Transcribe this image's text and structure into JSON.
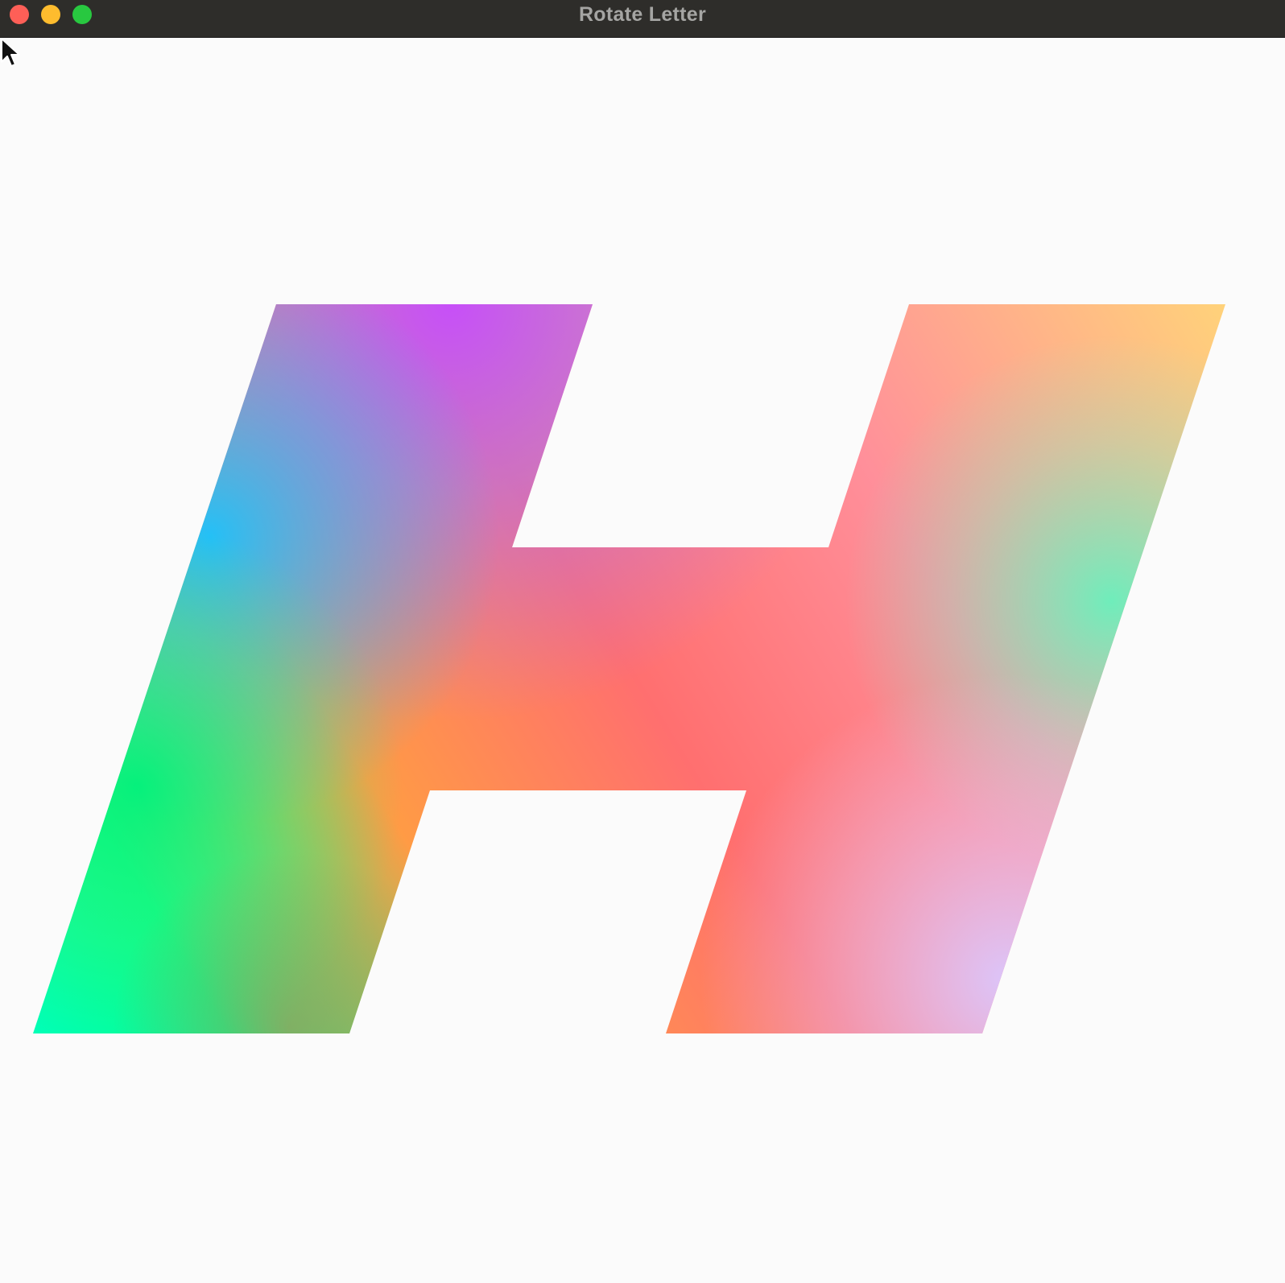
{
  "window": {
    "title": "Rotate Letter",
    "controls": {
      "close": {
        "color": "#fe5f57"
      },
      "minimize": {
        "color": "#febc2e"
      },
      "zoom": {
        "color": "#28c840"
      }
    }
  },
  "canvas": {
    "background": "#fbfbfb",
    "glyph": {
      "letter": "H",
      "style": "italic-skewed",
      "gradient_colors": [
        "#b44dff",
        "#1ec8ff",
        "#00ff8a",
        "#ff9a4a",
        "#ff5f6d",
        "#ffd27a",
        "#6bffbf",
        "#d9c6ff",
        "#ffb3d1"
      ]
    }
  },
  "cursor": {
    "icon": "arrow-pointer-icon"
  }
}
